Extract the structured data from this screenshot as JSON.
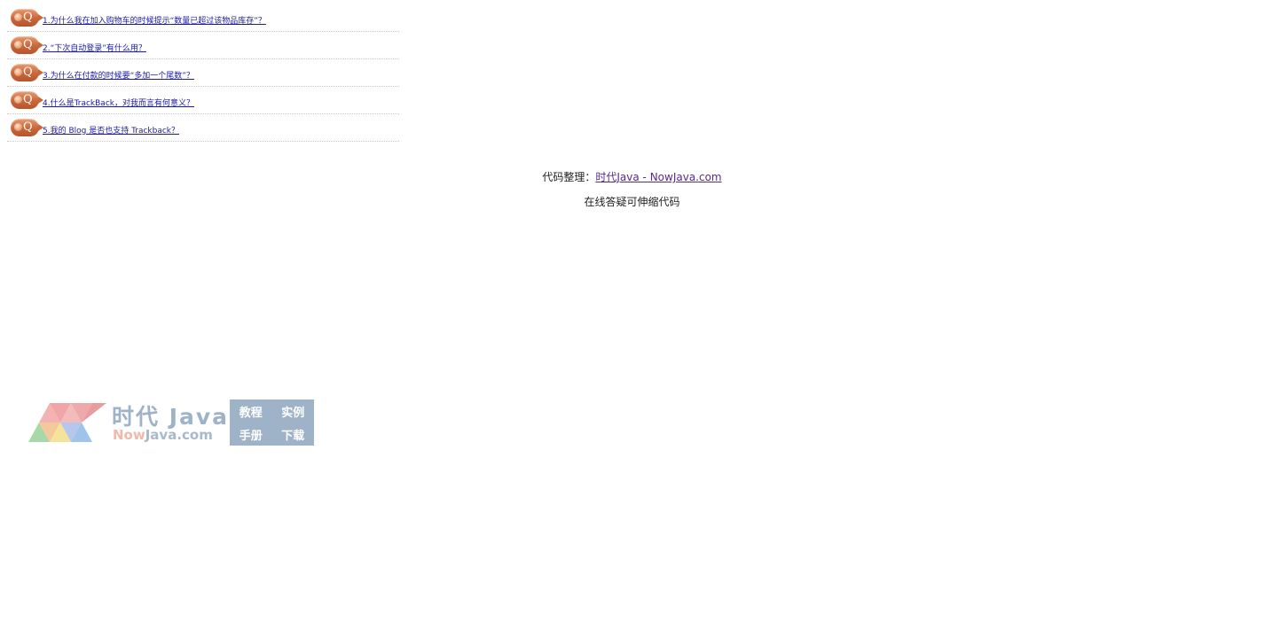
{
  "faq": {
    "badge_letter": "Q",
    "items": [
      {
        "label": "1.为什么我在加入购物车的时候提示“数量已超过该物品库存”？"
      },
      {
        "label": "2.“下次自动登录”有什么用？"
      },
      {
        "label": "3.为什么在付款的时候要“多加一个尾数”？"
      },
      {
        "label": "4.什么是TrackBack，对我而言有何意义？"
      },
      {
        "label": "5.我的 Blog 是否也支持 Trackback？"
      }
    ]
  },
  "credits": {
    "prefix": "代码整理：",
    "link_label": "时代Java - NowJava.com",
    "subtitle": "在线答疑可伸缩代码"
  },
  "logo": {
    "cn_title": "时代 Java",
    "en_now": "Now",
    "en_rest": "Java.com",
    "tags": [
      "教程",
      "实例",
      "手册",
      "下载"
    ]
  },
  "colors": {
    "badge": "#c9663a",
    "link": "#1a1aa6",
    "credit_link": "#5a2a8a",
    "logo_blue": "#9fb3c8",
    "logo_pink": "#f0b9a9"
  }
}
